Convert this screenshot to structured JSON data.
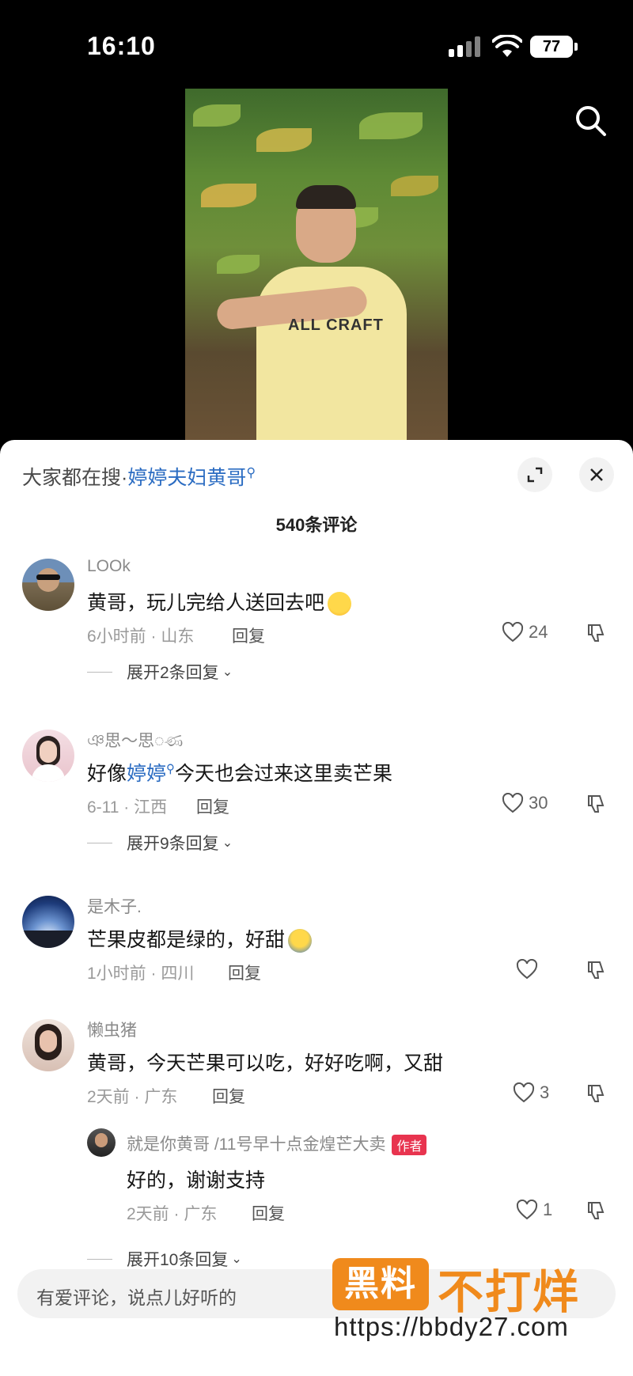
{
  "status_bar": {
    "time": "16:10",
    "battery": "77"
  },
  "sheet": {
    "trending_prefix": "大家都在搜·",
    "trending_term": "婷婷夫妇黄哥",
    "comment_count": "540条评论"
  },
  "comments": [
    {
      "username": "LOOk",
      "text": "黄哥，玩儿完给人送回去吧",
      "meta": "6小时前 · 山东",
      "reply_label": "回复",
      "likes": "24",
      "expand": "展开2条回复"
    },
    {
      "username": "ঞ思～思◌ණ",
      "text_before": "好像",
      "text_link": "婷婷",
      "text_after": "今天也会过来这里卖芒果",
      "meta": "6-11 · 江西",
      "reply_label": "回复",
      "likes": "30",
      "expand": "展开9条回复"
    },
    {
      "username": "是木子.",
      "text": "芒果皮都是绿的，好甜",
      "meta": "1小时前 · 四川",
      "reply_label": "回复",
      "likes": ""
    },
    {
      "username": "懒虫猪",
      "text": "黄哥，今天芒果可以吃，好好吃啊，又甜",
      "meta": "2天前 · 广东",
      "reply_label": "回复",
      "likes": "3",
      "reply": {
        "username": "就是你黄哥 /11号早十点金煌芒大卖",
        "badge": "作者",
        "text": "好的，谢谢支持",
        "meta": "2天前 · 广东",
        "reply_label": "回复",
        "likes": "1"
      },
      "expand": "展开10条回复"
    }
  ],
  "input": {
    "placeholder": "有爱评论，说点儿好听的"
  },
  "video": {
    "shirt_print": "ALL CRAFT"
  },
  "watermark": {
    "logo": "黑料",
    "text": "不打烊",
    "url": "https://bbdy27.com"
  }
}
